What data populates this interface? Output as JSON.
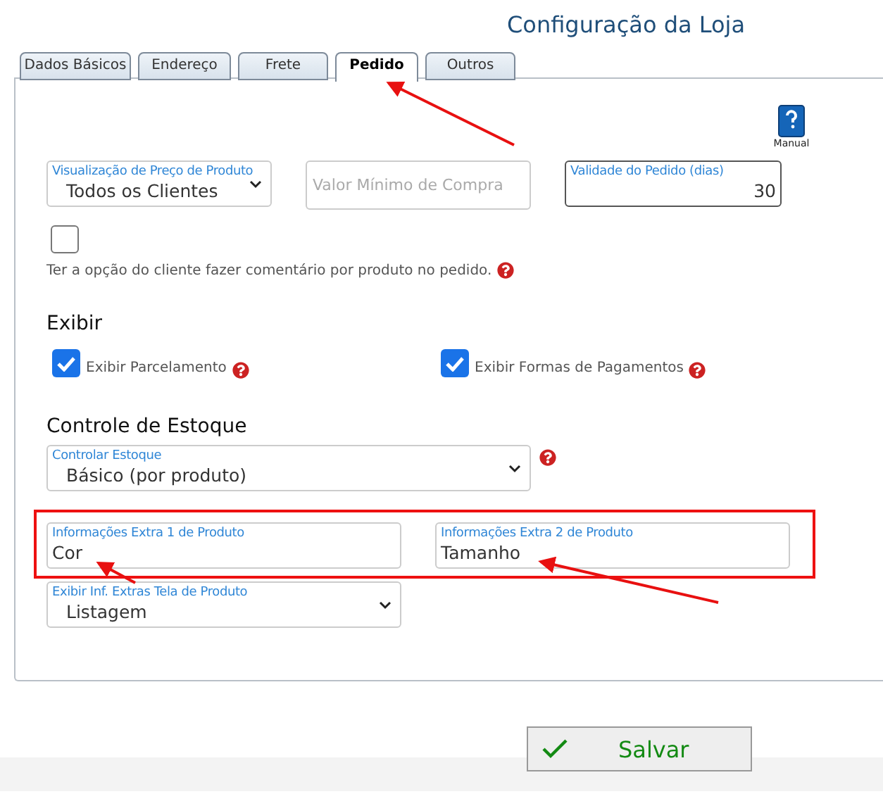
{
  "title": "Configuração da Loja",
  "tabs": [
    {
      "label": "Dados Básicos",
      "selected": false
    },
    {
      "label": "Endereço",
      "selected": false
    },
    {
      "label": "Frete",
      "selected": false
    },
    {
      "label": "Pedido",
      "selected": true
    },
    {
      "label": "Outros",
      "selected": false
    }
  ],
  "manual": {
    "label": "Manual"
  },
  "fields_row": [
    {
      "kind": "select",
      "label": "Visualização de Preço de Produto",
      "value": "Todos os Clientes"
    },
    {
      "kind": "input",
      "placeholder": "Valor Mínimo de Compra"
    },
    {
      "kind": "number",
      "label": "Validade do Pedido (dias)",
      "value": "30"
    }
  ],
  "comment_option": {
    "checked": false,
    "text": "Ter a opção do cliente fazer comentário por produto no pedido."
  },
  "exibir": {
    "heading": "Exibir",
    "options": [
      {
        "label": "Exibir Parcelamento",
        "checked": true
      },
      {
        "label": "Exibir Formas de Pagamentos",
        "checked": true
      }
    ]
  },
  "estoque": {
    "heading": "Controle de Estoque",
    "label": "Controlar Estoque",
    "value": "Básico (por produto)"
  },
  "extras": [
    {
      "label": "Informações Extra 1 de Produto",
      "value": "Cor"
    },
    {
      "label": "Informações Extra 2 de Produto",
      "value": "Tamanho"
    }
  ],
  "extras_display": {
    "label": "Exibir Inf. Extras Tela de Produto",
    "value": "Listagem"
  },
  "save_button": "Salvar"
}
